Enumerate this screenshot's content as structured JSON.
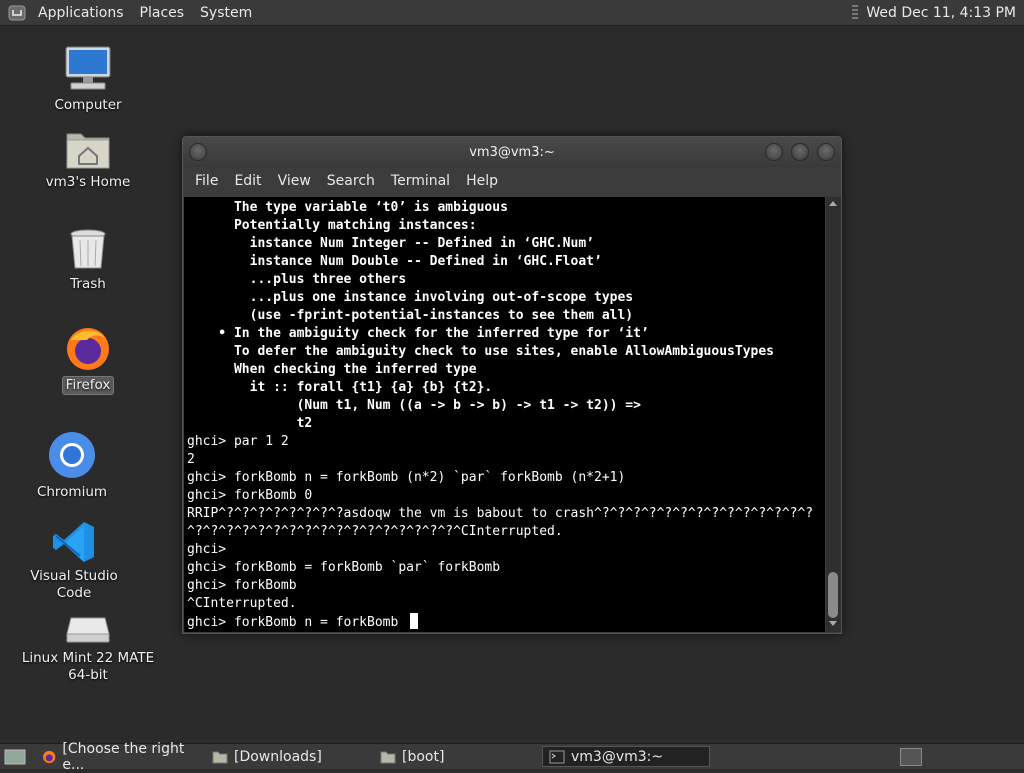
{
  "top_panel": {
    "menus": [
      "Applications",
      "Places",
      "System"
    ],
    "clock": "Wed Dec 11,  4:13 PM"
  },
  "desktop_icons": [
    {
      "label": "Computer",
      "icon": "computer-icon"
    },
    {
      "label": "vm3's Home",
      "icon": "home-folder-icon"
    },
    {
      "label": "Trash",
      "icon": "trash-icon"
    },
    {
      "label": "Firefox",
      "icon": "firefox-icon"
    },
    {
      "label": "Chromium",
      "icon": "chromium-icon"
    },
    {
      "label": "Visual Studio Code",
      "icon": "vscode-icon"
    },
    {
      "label": "Linux Mint 22 MATE\n64-bit",
      "icon": "disc-drive-icon"
    }
  ],
  "terminal": {
    "title": "vm3@vm3:~",
    "menu": [
      "File",
      "Edit",
      "View",
      "Search",
      "Terminal",
      "Help"
    ],
    "lines": [
      {
        "t": "      The type variable ‘t0’ is ambiguous",
        "b": true
      },
      {
        "t": "      Potentially matching instances:",
        "b": true
      },
      {
        "t": "        instance Num Integer -- Defined in ‘GHC.Num’",
        "b": true
      },
      {
        "t": "        instance Num Double -- Defined in ‘GHC.Float’",
        "b": true
      },
      {
        "t": "        ...plus three others",
        "b": true
      },
      {
        "t": "        ...plus one instance involving out-of-scope types",
        "b": true
      },
      {
        "t": "        (use -fprint-potential-instances to see them all)",
        "b": true
      },
      {
        "t": "    • In the ambiguity check for the inferred type for ‘it’",
        "b": true
      },
      {
        "t": "      To defer the ambiguity check to use sites, enable AllowAmbiguousTypes",
        "b": true
      },
      {
        "t": "      When checking the inferred type",
        "b": true
      },
      {
        "t": "        it :: forall {t1} {a} {b} {t2}.",
        "b": true
      },
      {
        "t": "              (Num t1, Num ((a -> b -> b) -> t1 -> t2)) =>",
        "b": true
      },
      {
        "t": "              t2",
        "b": true
      },
      {
        "t": "ghci> par 1 2",
        "b": false
      },
      {
        "t": "2",
        "b": false
      },
      {
        "t": "ghci> forkBomb n = forkBomb (n*2) `par` forkBomb (n*2+1)",
        "b": false
      },
      {
        "t": "ghci> forkBomb 0",
        "b": false
      },
      {
        "t": "RRIP^?^?^?^?^?^?^?^?asdoqw the vm is babout to crash^?^?^?^?^?^?^?^?^?^?^?^?^?^?",
        "b": false
      },
      {
        "t": "^?^?^?^?^?^?^?^?^?^?^?^?^?^?^?^?^?^CInterrupted.",
        "b": false
      },
      {
        "t": "ghci>",
        "b": false
      },
      {
        "t": "ghci> forkBomb = forkBomb `par` forkBomb",
        "b": false
      },
      {
        "t": "ghci> forkBomb",
        "b": false
      },
      {
        "t": "^CInterrupted.",
        "b": false
      },
      {
        "t": "ghci> forkBomb n = forkBomb",
        "b": false
      }
    ]
  },
  "taskbar": {
    "tasks": [
      {
        "label": "[Choose the right e...",
        "icon": "firefox-icon",
        "active": false
      },
      {
        "label": "[Downloads]",
        "icon": "folder-icon",
        "active": false
      },
      {
        "label": "[boot]",
        "icon": "folder-icon",
        "active": false
      },
      {
        "label": "vm3@vm3:~",
        "icon": "terminal-icon",
        "active": true
      }
    ]
  }
}
